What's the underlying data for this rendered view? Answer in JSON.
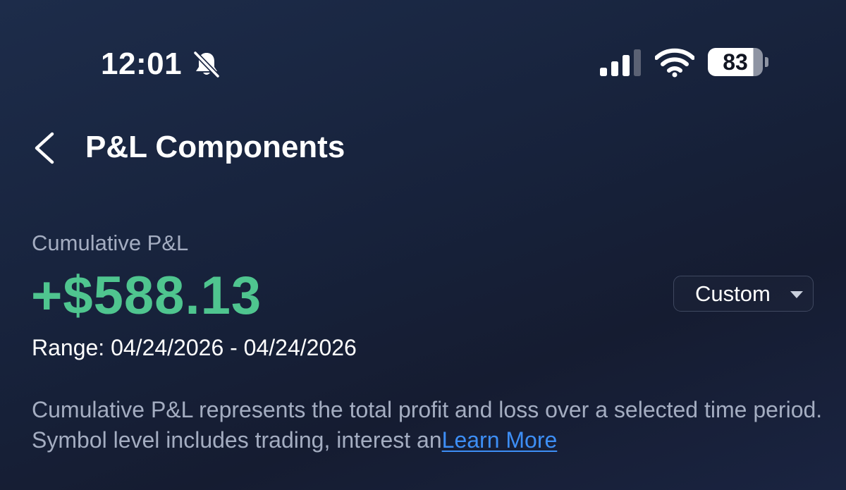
{
  "status_bar": {
    "time": "12:01",
    "battery_level": "83",
    "icons": [
      "bell-slash-icon",
      "cellular-signal-icon",
      "wifi-icon",
      "battery-icon"
    ]
  },
  "header": {
    "back_icon": "chevron-left-icon",
    "title": "P&L Components"
  },
  "summary": {
    "label": "Cumulative P&L",
    "value": "+$588.13",
    "range": "Range: 04/24/2026 - 04/24/2026",
    "dropdown": {
      "selected": "Custom",
      "icon": "caret-down-icon"
    }
  },
  "description": {
    "text": "Cumulative P&L represents the total profit and loss over a selected time period. Symbol level includes trading, interest an",
    "link": "Learn More"
  },
  "colors": {
    "background": "#17223b",
    "positive": "#4fc58f",
    "link": "#3d8ef5",
    "muted_text": "#a4adc1"
  }
}
